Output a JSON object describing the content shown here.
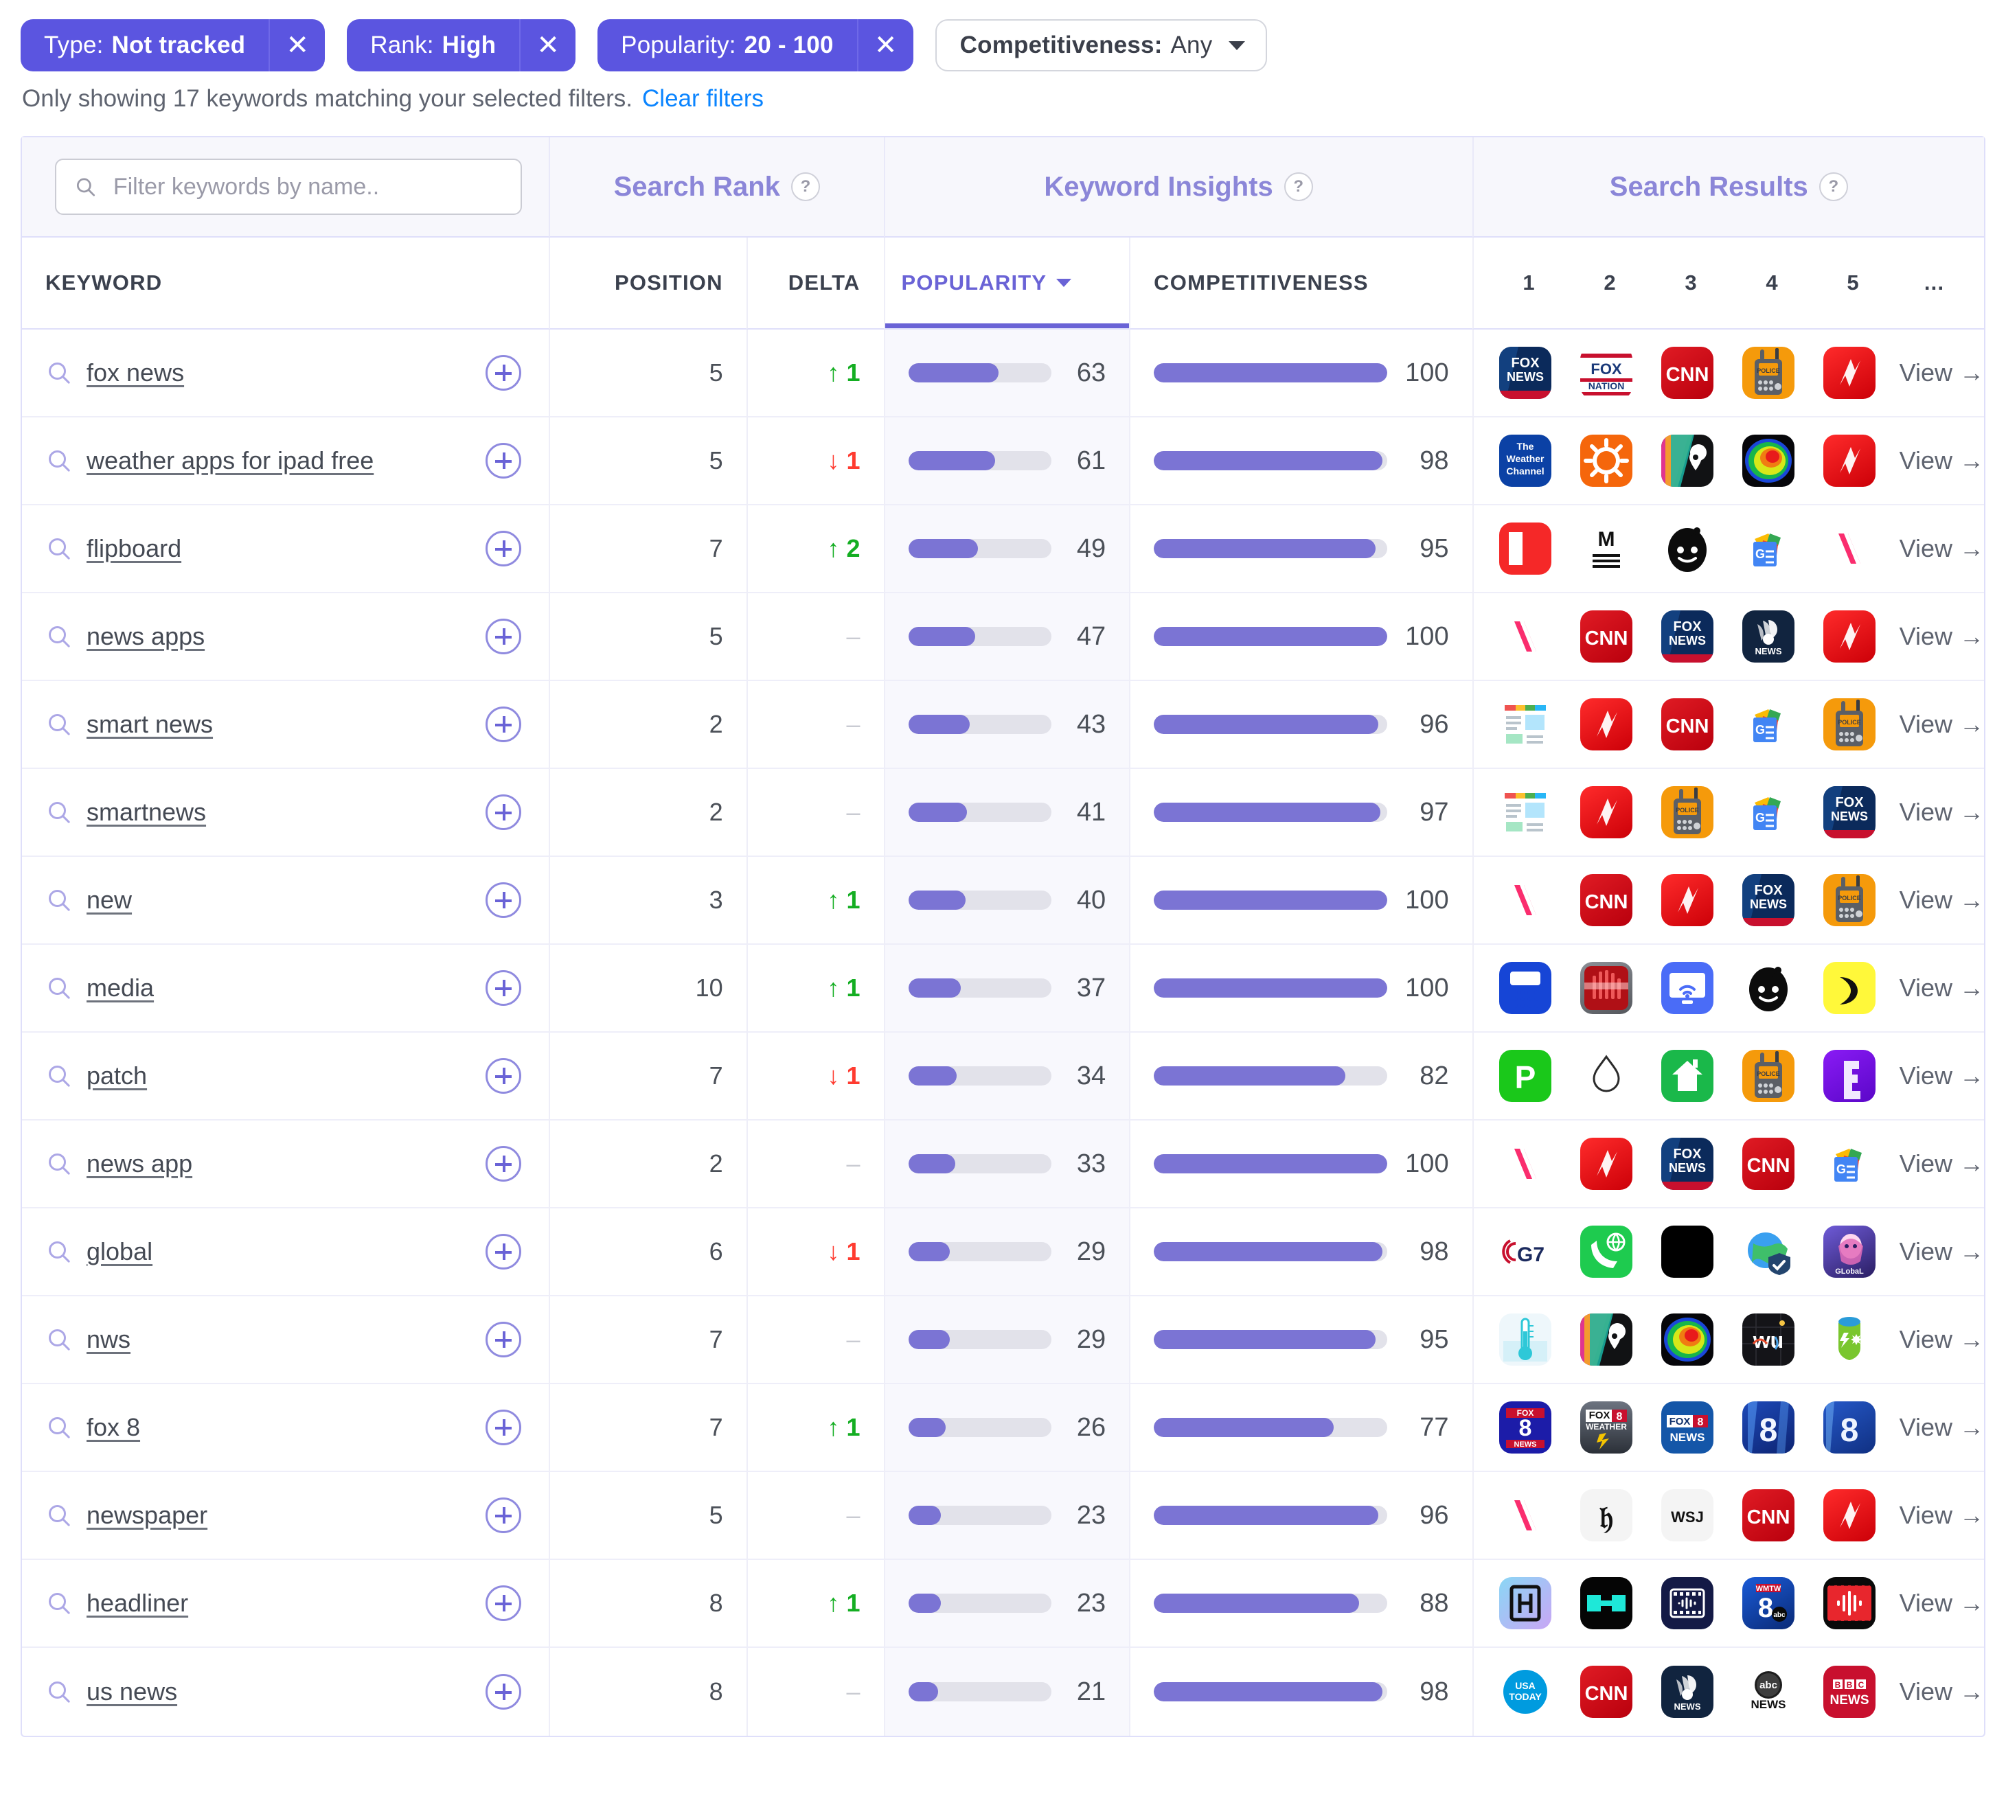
{
  "filters": {
    "chips": [
      {
        "label": "Type:",
        "value": "Not tracked",
        "close": "✕",
        "removable": true
      },
      {
        "label": "Rank:",
        "value": "High",
        "close": "✕",
        "removable": true
      },
      {
        "label": "Popularity:",
        "value": "20 - 100",
        "close": "✕",
        "removable": true
      },
      {
        "label": "Competitiveness:",
        "value": "Any",
        "close": "",
        "removable": false
      }
    ]
  },
  "status": {
    "text": "Only showing 17 keywords matching your selected filters.",
    "clear_label": "Clear filters"
  },
  "search": {
    "placeholder": "Filter keywords by name.."
  },
  "groups": {
    "search_rank": {
      "label": "Search Rank",
      "help": "?"
    },
    "keyword_insights": {
      "label": "Keyword Insights",
      "help": "?"
    },
    "search_results": {
      "label": "Search Results",
      "help": "?"
    }
  },
  "columns": {
    "keyword": "KEYWORD",
    "position": "POSITION",
    "delta": "DELTA",
    "popularity": "POPULARITY",
    "competitiveness": "COMPETITIVENESS",
    "result_ranks": [
      "1",
      "2",
      "3",
      "4",
      "5",
      "..."
    ]
  },
  "sort": {
    "column": "POPULARITY",
    "direction": "desc"
  },
  "view_label": "View →",
  "colors": {
    "accent": "#5b55e0",
    "bar": "#7b74d4",
    "bar_track": "#e2e2ea",
    "up": "#14ae22",
    "down": "#ff3b30",
    "link": "#0a84ff",
    "group_title": "#8b86d8"
  },
  "chart_data": {
    "type": "table",
    "title": "Keyword Insights table",
    "columns": [
      "KEYWORD",
      "POSITION",
      "DELTA",
      "POPULARITY",
      "COMPETITIVENESS"
    ],
    "rows": [
      {
        "keyword": "fox news",
        "position": 5,
        "delta": 1,
        "delta_dir": "up",
        "popularity": 63,
        "competitiveness": 100
      },
      {
        "keyword": "weather apps for ipad free",
        "position": 5,
        "delta": 1,
        "delta_dir": "down",
        "popularity": 61,
        "competitiveness": 98
      },
      {
        "keyword": "flipboard",
        "position": 7,
        "delta": 2,
        "delta_dir": "up",
        "popularity": 49,
        "competitiveness": 95
      },
      {
        "keyword": "news apps",
        "position": 5,
        "delta": 0,
        "delta_dir": "flat",
        "popularity": 47,
        "competitiveness": 100
      },
      {
        "keyword": "smart news",
        "position": 2,
        "delta": 0,
        "delta_dir": "flat",
        "popularity": 43,
        "competitiveness": 96
      },
      {
        "keyword": "smartnews",
        "position": 2,
        "delta": 0,
        "delta_dir": "flat",
        "popularity": 41,
        "competitiveness": 97
      },
      {
        "keyword": "new",
        "position": 3,
        "delta": 1,
        "delta_dir": "up",
        "popularity": 40,
        "competitiveness": 100
      },
      {
        "keyword": "media",
        "position": 10,
        "delta": 1,
        "delta_dir": "up",
        "popularity": 37,
        "competitiveness": 100
      },
      {
        "keyword": "patch",
        "position": 7,
        "delta": 1,
        "delta_dir": "down",
        "popularity": 34,
        "competitiveness": 82
      },
      {
        "keyword": "news app",
        "position": 2,
        "delta": 0,
        "delta_dir": "flat",
        "popularity": 33,
        "competitiveness": 100
      },
      {
        "keyword": "global",
        "position": 6,
        "delta": 1,
        "delta_dir": "down",
        "popularity": 29,
        "competitiveness": 98
      },
      {
        "keyword": "nws",
        "position": 7,
        "delta": 0,
        "delta_dir": "flat",
        "popularity": 29,
        "competitiveness": 95
      },
      {
        "keyword": "fox 8",
        "position": 7,
        "delta": 1,
        "delta_dir": "up",
        "popularity": 26,
        "competitiveness": 77
      },
      {
        "keyword": "newspaper",
        "position": 5,
        "delta": 0,
        "delta_dir": "flat",
        "popularity": 23,
        "competitiveness": 96
      },
      {
        "keyword": "headliner",
        "position": 8,
        "delta": 1,
        "delta_dir": "up",
        "popularity": 23,
        "competitiveness": 88
      },
      {
        "keyword": "us news",
        "position": 8,
        "delta": 0,
        "delta_dir": "flat",
        "popularity": 21,
        "competitiveness": 98
      }
    ],
    "popularity_range": [
      0,
      100
    ],
    "competitiveness_range": [
      0,
      100
    ]
  },
  "rows": [
    {
      "keyword": "fox news",
      "position": "5",
      "delta": "1",
      "delta_dir": "up",
      "popularity": 63,
      "competitiveness": 100,
      "apps": [
        "fox-news",
        "fox-nation",
        "cnn",
        "police-scanner",
        "newsbreak"
      ]
    },
    {
      "keyword": "weather apps for ipad free",
      "position": "5",
      "delta": "1",
      "delta_dir": "down",
      "popularity": 61,
      "competitiveness": 98,
      "apps": [
        "the-weather-channel",
        "weather-sun",
        "radar-map-pin",
        "radar-storm",
        "newsbreak"
      ]
    },
    {
      "keyword": "flipboard",
      "position": "7",
      "delta": "2",
      "delta_dir": "up",
      "popularity": 49,
      "competitiveness": 95,
      "apps": [
        "flipboard",
        "medium",
        "reddit",
        "google-news",
        "apple-news"
      ]
    },
    {
      "keyword": "news apps",
      "position": "5",
      "delta": "",
      "delta_dir": "flat",
      "popularity": 47,
      "competitiveness": 100,
      "apps": [
        "apple-news",
        "cnn",
        "fox-news",
        "nbc-news",
        "newsbreak"
      ]
    },
    {
      "keyword": "smart news",
      "position": "2",
      "delta": "",
      "delta_dir": "flat",
      "popularity": 43,
      "competitiveness": 96,
      "apps": [
        "smartnews",
        "newsbreak",
        "cnn",
        "google-news",
        "police-scanner"
      ]
    },
    {
      "keyword": "smartnews",
      "position": "2",
      "delta": "",
      "delta_dir": "flat",
      "popularity": 41,
      "competitiveness": 97,
      "apps": [
        "smartnews",
        "newsbreak",
        "police-scanner",
        "google-news",
        "fox-news"
      ]
    },
    {
      "keyword": "new",
      "position": "3",
      "delta": "1",
      "delta_dir": "up",
      "popularity": 40,
      "competitiveness": 100,
      "apps": [
        "apple-news",
        "cnn",
        "newsbreak",
        "fox-news",
        "police-scanner"
      ]
    },
    {
      "keyword": "media",
      "position": "10",
      "delta": "1",
      "delta_dir": "up",
      "popularity": 37,
      "competitiveness": 100,
      "apps": [
        "media-remote",
        "xray-scanner",
        "screen-cast",
        "reddit",
        "smiley-yellow"
      ]
    },
    {
      "keyword": "patch",
      "position": "7",
      "delta": "1",
      "delta_dir": "down",
      "popularity": 34,
      "competitiveness": 82,
      "apps": [
        "parking-p",
        "water-drop",
        "home-green",
        "police-scanner",
        "purple-e"
      ]
    },
    {
      "keyword": "news app",
      "position": "2",
      "delta": "",
      "delta_dir": "flat",
      "popularity": 33,
      "competitiveness": 100,
      "apps": [
        "apple-news",
        "newsbreak",
        "fox-news",
        "cnn",
        "google-news"
      ]
    },
    {
      "keyword": "global",
      "position": "6",
      "delta": "1",
      "delta_dir": "down",
      "popularity": 29,
      "competitiveness": 98,
      "apps": [
        "g7",
        "phone-globe",
        "black-square",
        "globe-shield",
        "global-game"
      ]
    },
    {
      "keyword": "nws",
      "position": "7",
      "delta": "",
      "delta_dir": "flat",
      "popularity": 29,
      "competitiveness": 95,
      "apps": [
        "thermometer",
        "radar-map-pin",
        "radar-storm",
        "weather-underground",
        "weather-bug"
      ]
    },
    {
      "keyword": "fox 8",
      "position": "7",
      "delta": "1",
      "delta_dir": "up",
      "popularity": 26,
      "competitiveness": 77,
      "apps": [
        "fox8-news",
        "fox8-weather",
        "fox8-news-blue",
        "channel-8",
        "channel-8-alt"
      ]
    },
    {
      "keyword": "newspaper",
      "position": "5",
      "delta": "",
      "delta_dir": "flat",
      "popularity": 23,
      "competitiveness": 96,
      "apps": [
        "apple-news",
        "nytimes",
        "wsj",
        "cnn",
        "newsbreak"
      ]
    },
    {
      "keyword": "headliner",
      "position": "8",
      "delta": "1",
      "delta_dir": "up",
      "popularity": 23,
      "competitiveness": 88,
      "apps": [
        "headliner-h",
        "headliner-teal",
        "film-audio",
        "wmtw-8",
        "audio-wave"
      ]
    },
    {
      "keyword": "us news",
      "position": "8",
      "delta": "",
      "delta_dir": "flat",
      "popularity": 21,
      "competitiveness": 98,
      "apps": [
        "usa-today",
        "cnn",
        "nbc-news",
        "abc-news",
        "bbc-news"
      ]
    }
  ]
}
